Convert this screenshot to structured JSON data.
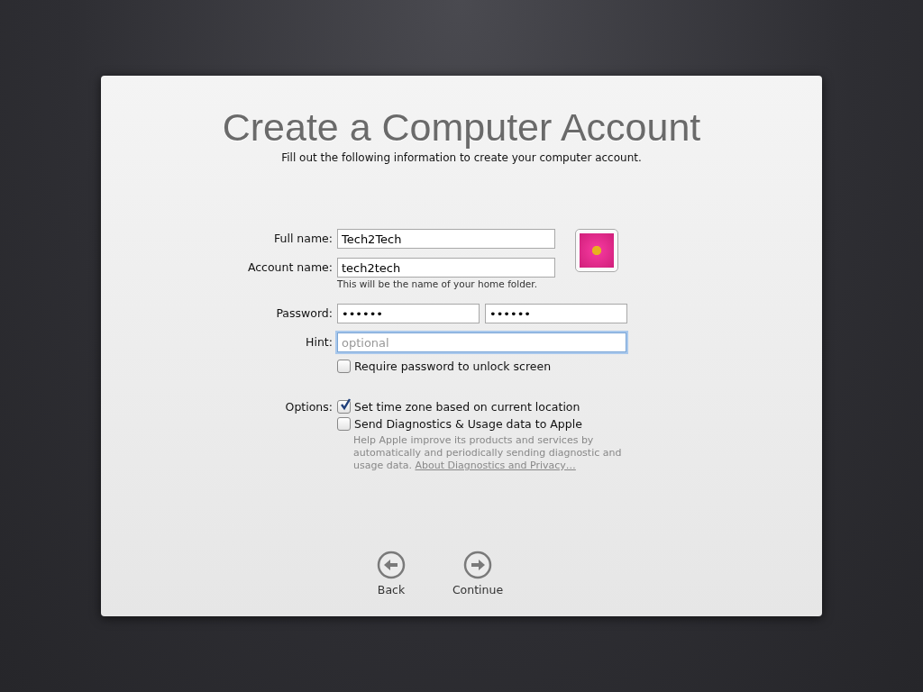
{
  "title": "Create a Computer Account",
  "subtitle": "Fill out the following information to create your computer account.",
  "full_name": {
    "label": "Full name:",
    "value": "Tech2Tech"
  },
  "account_name": {
    "label": "Account name:",
    "value": "tech2tech",
    "note": "This will be the name of your home folder."
  },
  "password": {
    "label": "Password:",
    "values": [
      "••••••",
      "••••••"
    ]
  },
  "hint": {
    "label": "Hint:",
    "placeholder": "optional",
    "focused": true
  },
  "lock_checkbox": {
    "label": "Require password to unlock screen",
    "checked": false
  },
  "options": {
    "label": "Options:",
    "items": [
      {
        "label": "Set time zone based on current location",
        "checked": true
      },
      {
        "label": "Send Diagnostics & Usage data to Apple",
        "checked": false
      }
    ],
    "description": "Help Apple improve its products and services by automatically and periodically sending diagnostic and usage data.",
    "link": "About Diagnostics and Privacy…"
  },
  "buttons": [
    {
      "label": "Back",
      "kind": "back"
    },
    {
      "label": "Continue",
      "kind": "continue"
    }
  ]
}
